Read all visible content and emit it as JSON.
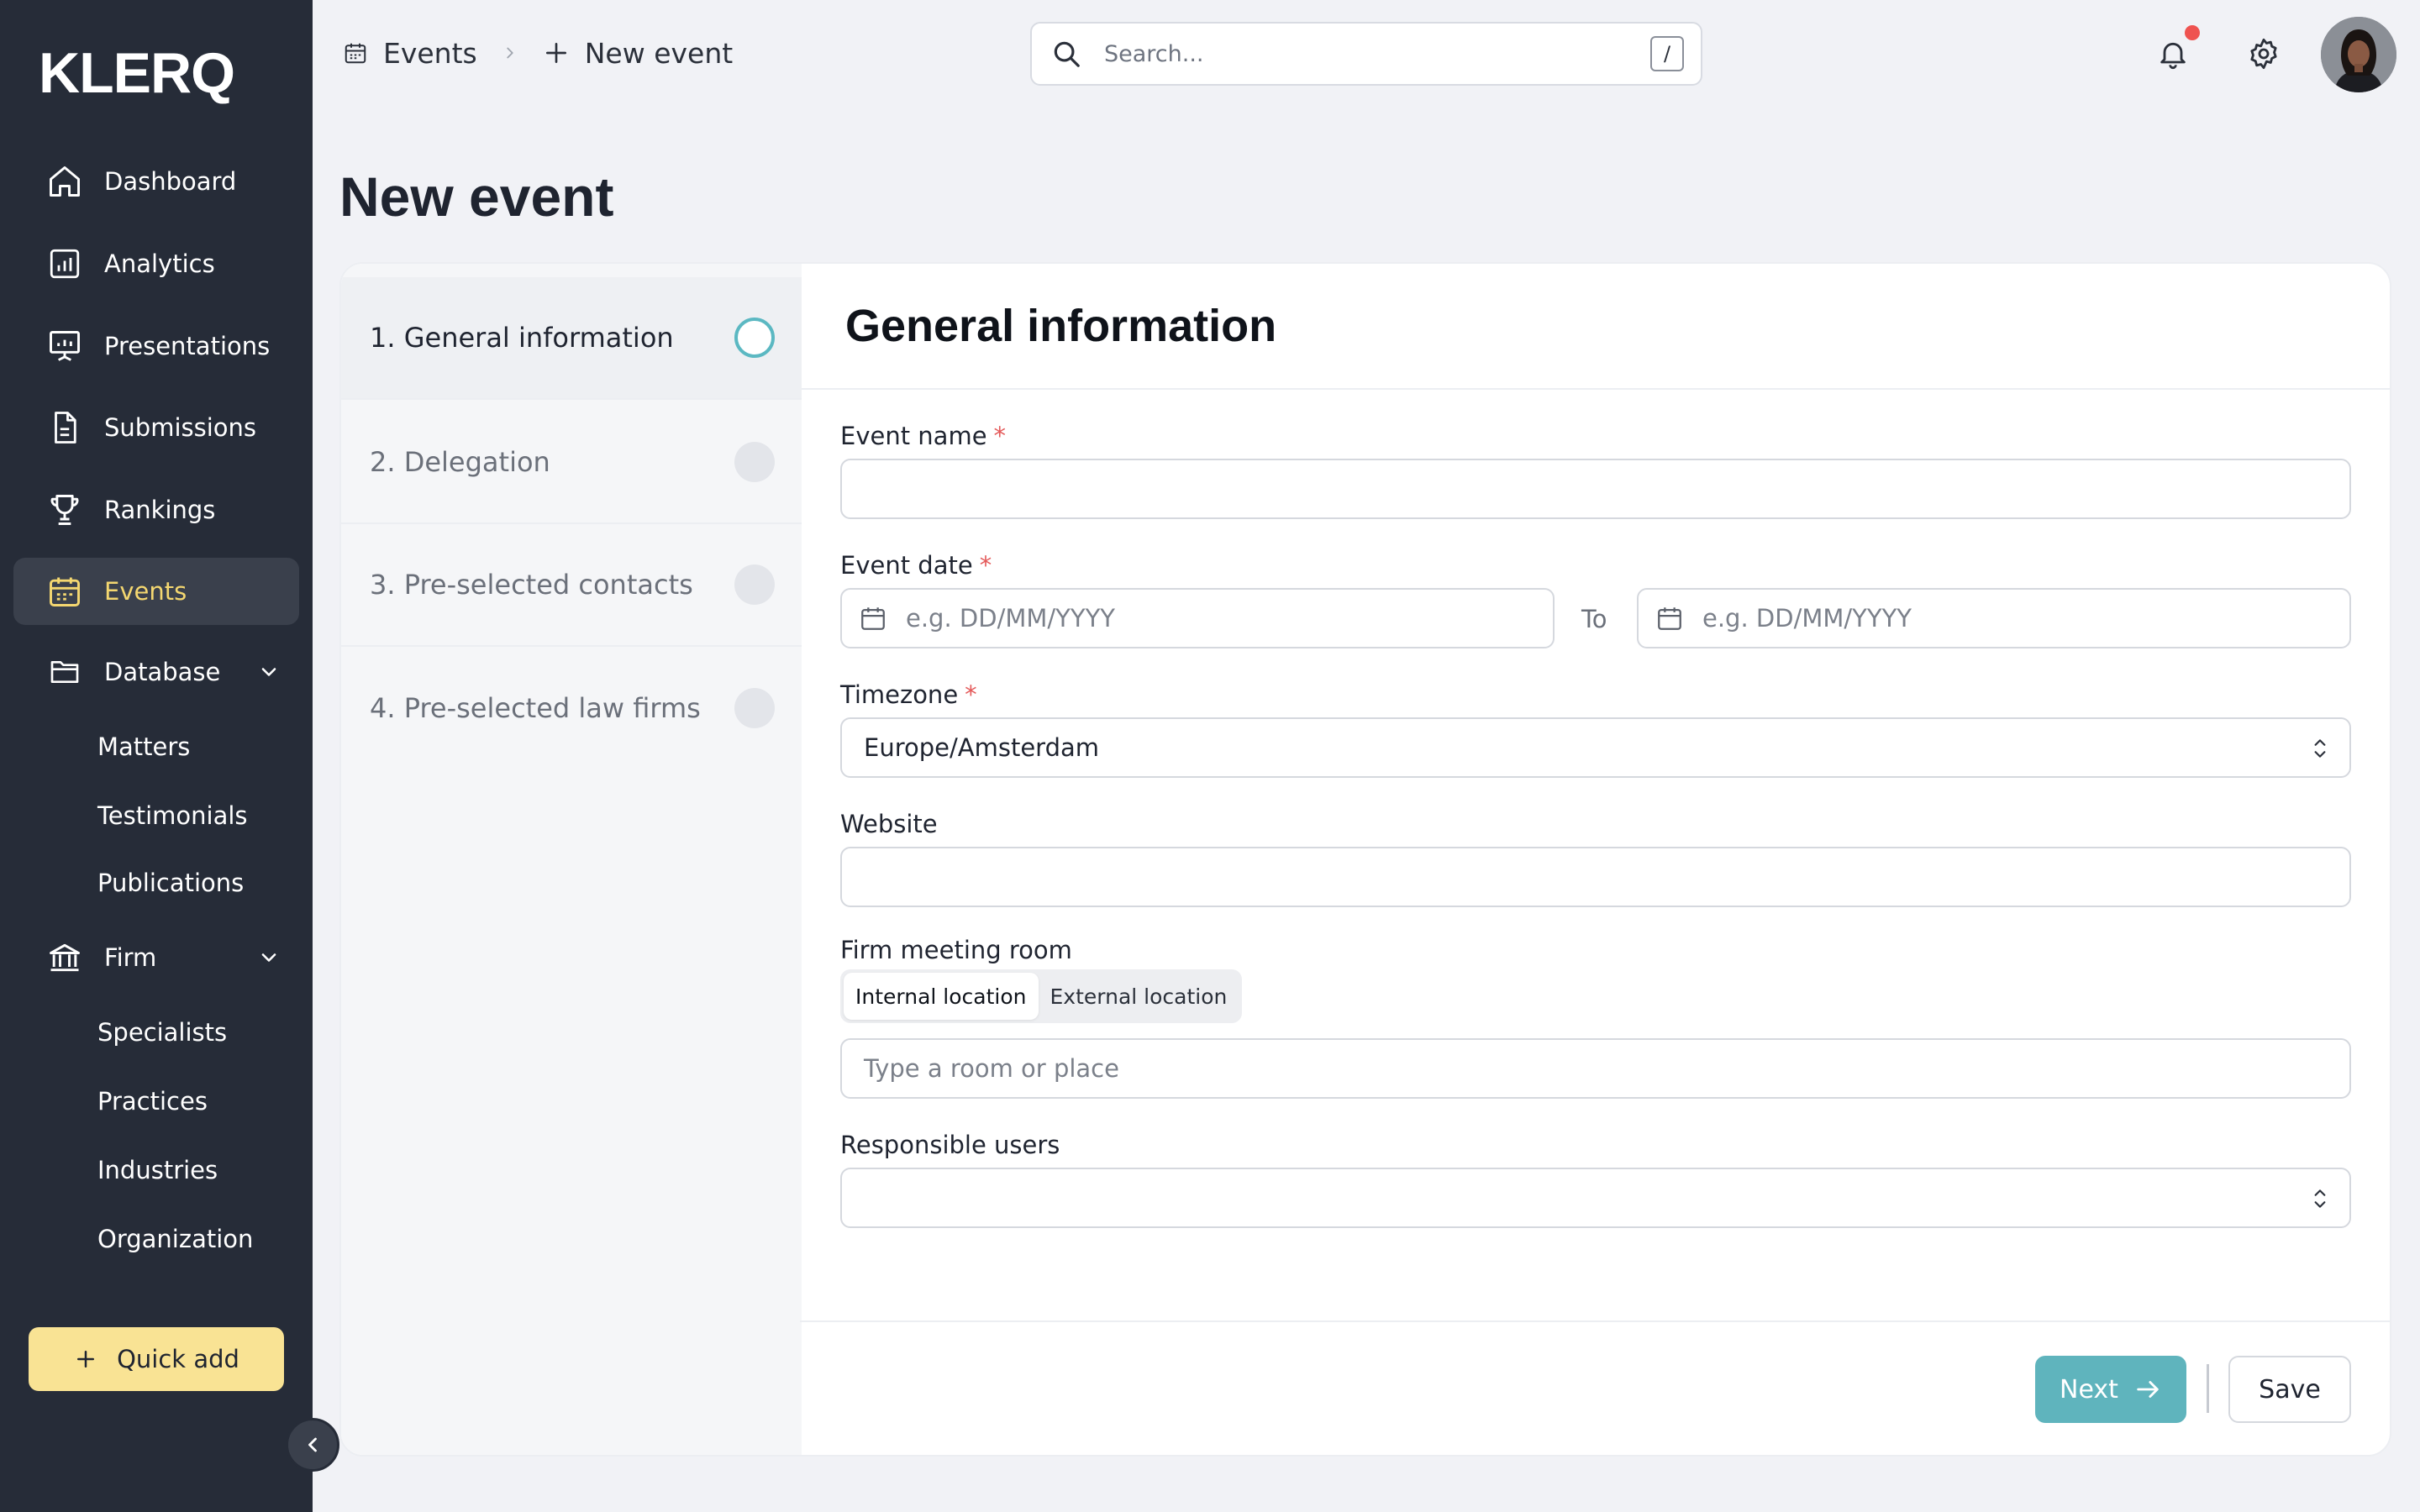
{
  "app": {
    "logo_text": "KLERQ"
  },
  "sidebar": {
    "items": [
      {
        "label": "Dashboard",
        "icon": "home-icon"
      },
      {
        "label": "Analytics",
        "icon": "analytics-icon"
      },
      {
        "label": "Presentations",
        "icon": "presentation-icon"
      },
      {
        "label": "Submissions",
        "icon": "document-icon"
      },
      {
        "label": "Rankings",
        "icon": "trophy-icon"
      },
      {
        "label": "Events",
        "icon": "calendar-icon",
        "active": true
      },
      {
        "label": "Database",
        "icon": "folder-icon",
        "expanded": true
      },
      {
        "label": "Firm",
        "icon": "bank-icon",
        "expanded": true
      }
    ],
    "database_children": [
      "Matters",
      "Testimonials",
      "Publications"
    ],
    "firm_children": [
      "Specialists",
      "Practices",
      "Industries",
      "Organization"
    ],
    "quick_add_label": "Quick add"
  },
  "topbar": {
    "breadcrumb": {
      "first": "Events",
      "current": "New event"
    },
    "search": {
      "placeholder": "Search...",
      "shortcut": "/"
    },
    "has_notification": true
  },
  "page": {
    "title": "New event"
  },
  "steps": [
    {
      "label": "1.  General information",
      "active": true
    },
    {
      "label": "2.  Delegation",
      "active": false
    },
    {
      "label": "3.  Pre-selected contacts",
      "active": false
    },
    {
      "label": "4.  Pre-selected law firms",
      "active": false
    }
  ],
  "form": {
    "title": "General information",
    "event_name": {
      "label": "Event name",
      "required_mark": "*",
      "value": ""
    },
    "event_date": {
      "label": "Event date",
      "required_mark": "*",
      "from_placeholder": "e.g. DD/MM/YYYY",
      "to_label": "To",
      "to_placeholder": "e.g. DD/MM/YYYY"
    },
    "timezone": {
      "label": "Timezone",
      "required_mark": "*",
      "value": "Europe/Amsterdam"
    },
    "website": {
      "label": "Website",
      "value": ""
    },
    "meeting_room": {
      "label": "Firm meeting room",
      "options": [
        "Internal location",
        "External location"
      ],
      "selected": "Internal location",
      "placeholder": "Type a room or place"
    },
    "responsible_users": {
      "label": "Responsible users",
      "value": ""
    }
  },
  "actions": {
    "next_label": "Next",
    "save_label": "Save"
  },
  "colors": {
    "sidebar_bg": "#262c38",
    "active_accent": "#f4d770",
    "quick_add_bg": "#f9e394",
    "primary_button": "#5fb4bd",
    "required": "#e45a5a",
    "notification_dot": "#ef5350"
  }
}
